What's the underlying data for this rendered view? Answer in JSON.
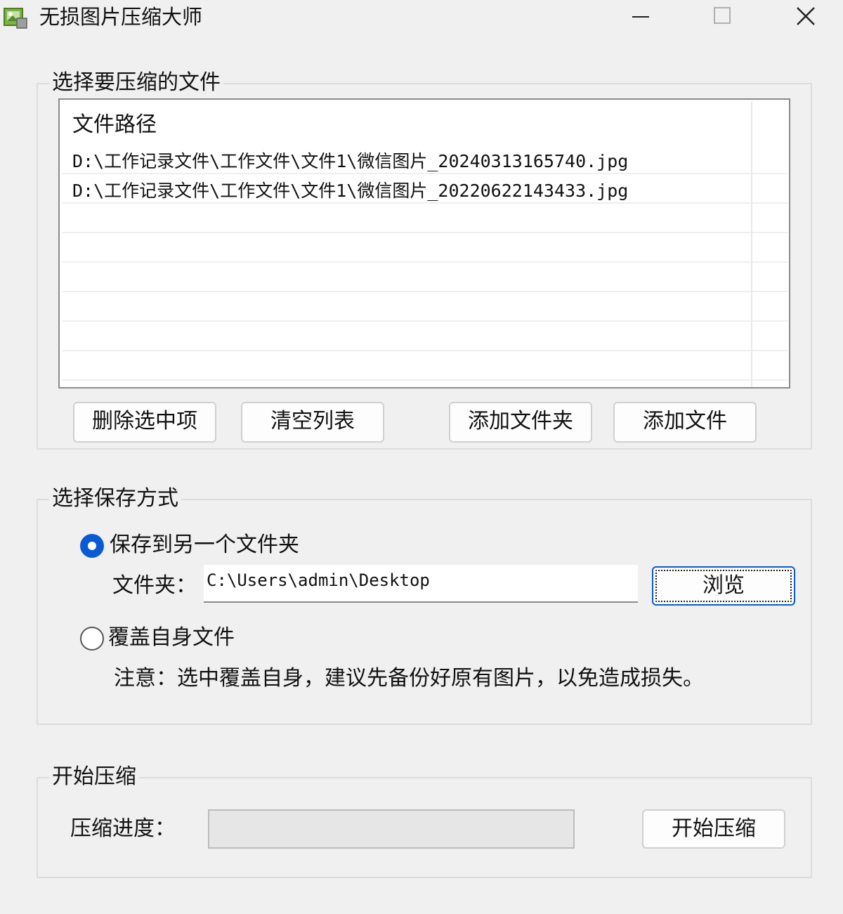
{
  "window": {
    "title": "无损图片压缩大师"
  },
  "file_group": {
    "title": "选择要压缩的文件",
    "list_header": "文件路径",
    "files": [
      "D:\\工作记录文件\\工作文件\\文件1\\微信图片_20240313165740.jpg",
      "D:\\工作记录文件\\工作文件\\文件1\\微信图片_20220622143433.jpg"
    ],
    "buttons": {
      "delete_selected": "删除选中项",
      "clear_list": "清空列表",
      "add_folder": "添加文件夹",
      "add_file": "添加文件"
    }
  },
  "save_group": {
    "title": "选择保存方式",
    "option_other_folder": "保存到另一个文件夹",
    "option_other_folder_selected": true,
    "folder_label": "文件夹：",
    "folder_path": "C:\\Users\\admin\\Desktop",
    "browse_button": "浏览",
    "option_overwrite": "覆盖自身文件",
    "option_overwrite_selected": false,
    "note": "注意：选中覆盖自身，建议先备份好原有图片，以免造成损失。"
  },
  "compress_group": {
    "title": "开始压缩",
    "progress_label": "压缩进度：",
    "progress_value": 0,
    "start_button": "开始压缩"
  },
  "colors": {
    "accent": "#0a5bd3",
    "background": "#f0f0f0"
  }
}
